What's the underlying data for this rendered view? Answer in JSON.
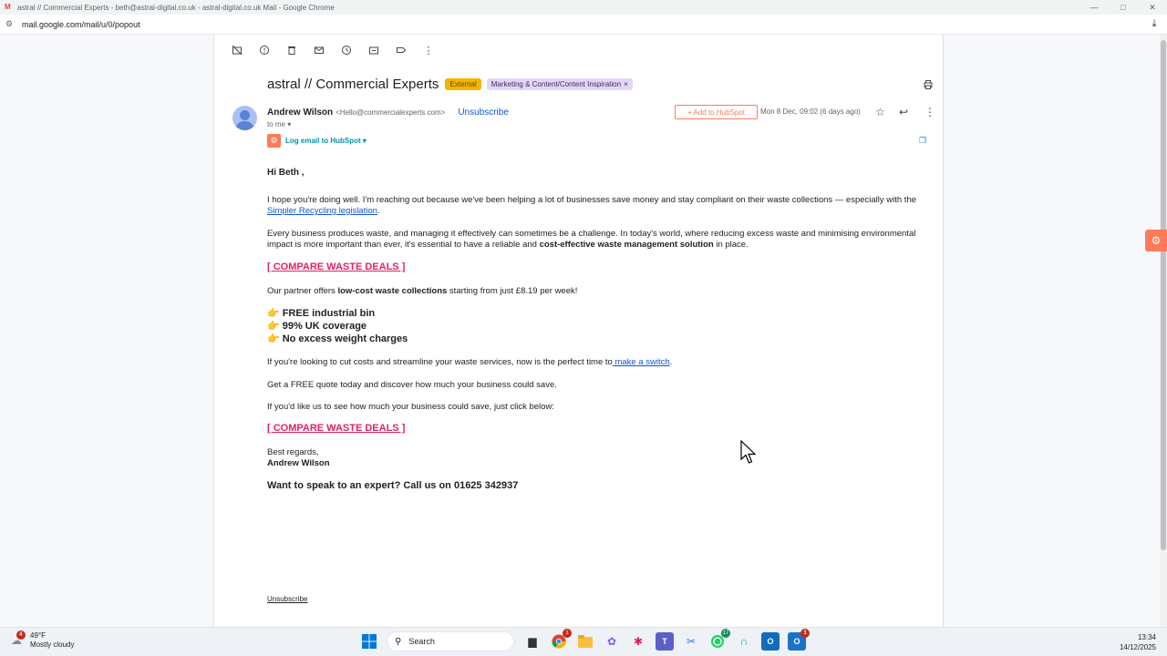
{
  "window": {
    "title": "astral // Commercial Experts - beth@astral-digital.co.uk - astral-digital.co.uk Mail - Google Chrome",
    "minimize": "—",
    "maximize": "□",
    "close": "✕"
  },
  "address_bar": {
    "url": "mail.google.com/mail/u/0/popout"
  },
  "toolbar": {
    "icons": [
      "archive-icon",
      "report-spam-icon",
      "delete-icon",
      "mark-unread-icon",
      "snooze-icon",
      "move-to-icon",
      "label-icon",
      "more-icon"
    ]
  },
  "email": {
    "subject": "astral // Commercial Experts",
    "badge_external": "External",
    "label_chip": "Marketing & Content/Content Inspiration",
    "label_chip_close": "×",
    "sender_name": "Andrew Wilson",
    "sender_address": "<Hello@commercialexperts.com>",
    "unsubscribe_link": "Unsubscribe",
    "to_me": "to me",
    "add_to_hubspot": "+ Add to HubSpot",
    "date": "Mon 8 Dec, 09:02 (6 days ago)",
    "log_email": "Log email to HubSpot",
    "body": {
      "greeting": "Hi Beth ,",
      "p1_a": "I hope you're doing well. I'm reaching out because we've been helping a lot of businesses save money and stay compliant on their waste collections — especially with the ",
      "p1_link": "Simpler Recycling legislation",
      "p1_b": ".",
      "p2_a": "Every business produces waste, and managing it effectively can sometimes be a challenge. In today's world, where reducing excess waste and minimising environmental impact is more important than ever, it's essential to have a reliable and ",
      "p2_bold": "cost-effective waste management solution",
      "p2_b": " in place.",
      "cta1": "[ COMPARE WASTE DEALS ]",
      "p3_a": "Our partner offers ",
      "p3_bold": "low-cost waste collections",
      "p3_b": " starting from just £8.19 per week!",
      "bullet_glyph": "👉",
      "bullets": [
        "FREE industrial bin",
        "99% UK coverage",
        "No excess weight charges"
      ],
      "p4_a": "If you're looking to cut costs and streamline your waste services, now is the perfect time to",
      "p4_link": " make a switch",
      "p4_b": ".",
      "p5": "Get a FREE quote today and discover how much your business could save.",
      "p6": "If you'd like us to see how much your business could save, just click below:",
      "cta2": "[ COMPARE WASTE DEALS ]",
      "regards": "Best regards,",
      "signature": "Andrew Wilson",
      "call_us": "Want to speak to an expert? Call us on 01625 342937",
      "footer_unsubscribe": "Unsubscribe"
    }
  },
  "taskbar": {
    "weather_temp": "49°F",
    "weather_desc": "Mostly cloudy",
    "weather_badge": "4",
    "search_placeholder": "Search",
    "chrome_badge": "1",
    "whatsapp_badge": "17",
    "outlook_badge": "1",
    "time": "13:34",
    "date": "14/12/2025"
  },
  "colors": {
    "accent_blue": "#0b57d0",
    "hubspot_orange": "#ff7a59",
    "cta_pink": "#e0245e",
    "external_badge": "#f4b400"
  }
}
